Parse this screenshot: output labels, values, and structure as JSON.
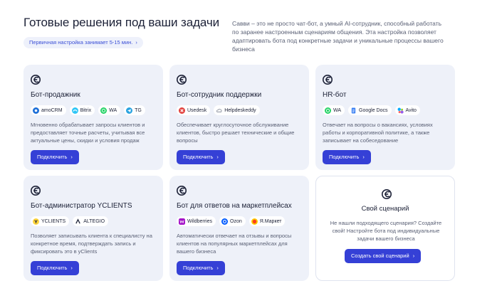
{
  "header": {
    "title": "Готовые решения под ваши задачи",
    "setup_chip": "Первичная настройка занимает 5-15 мин.",
    "intro": "Савви – это не просто чат-бот, а умный AI-сотрудник, способный работать по заранее настроенным сценариям общения. Эта настройка позволяет адаптировать бота под конкретные задачи и уникальные процессы вашего бизнеса"
  },
  "colors": {
    "accent": "#3540d6",
    "card_bg": "#eef1f9",
    "chip_bg": "#eef1fb"
  },
  "cards": [
    {
      "title": "Бот-продажник",
      "tags": [
        {
          "label": "amoCRM",
          "icon": "amocrm-icon"
        },
        {
          "label": "Bitrix",
          "icon": "bitrix-icon"
        },
        {
          "label": "WA",
          "icon": "whatsapp-icon"
        },
        {
          "label": "TG",
          "icon": "telegram-icon"
        }
      ],
      "desc": "Мгновенно обрабатывает запросы клиентов и предоставляет точные расчеты, учитывая все актуальные цены, скидки и условия продаж",
      "button": "Подключить"
    },
    {
      "title": "Бот-сотрудник поддержки",
      "tags": [
        {
          "label": "Usedesk",
          "icon": "usedesk-icon"
        },
        {
          "label": "Helpdeskeddy",
          "icon": "helpdeskeddy-icon"
        }
      ],
      "desc": "Обеспечивает круглосуточное обслуживание клиентов, быстро решает технические и общие вопросы",
      "button": "Подключить"
    },
    {
      "title": "HR-бот",
      "tags": [
        {
          "label": "WA",
          "icon": "whatsapp-icon"
        },
        {
          "label": "Google Docs",
          "icon": "google-docs-icon"
        },
        {
          "label": "Avito",
          "icon": "avito-icon"
        }
      ],
      "desc": "Отвечает на вопросы о вакансиях, условиях работы и корпоративной политике, а также записывает на собеседование",
      "button": "Подключить"
    },
    {
      "title": "Бот-администратор YCLIENTS",
      "tags": [
        {
          "label": "YCLIENTS",
          "icon": "yclients-icon"
        },
        {
          "label": "ALTEGIO",
          "icon": "altegio-icon"
        }
      ],
      "desc": "Позволяет записывать клиента к специалисту на конкретное время, подтверждать запись и фиксировать это в yClients",
      "button": "Подключить"
    },
    {
      "title": "Бот для ответов на маркетплейсах",
      "tags": [
        {
          "label": "Wildberries",
          "icon": "wildberries-icon"
        },
        {
          "label": "Ozon",
          "icon": "ozon-icon"
        },
        {
          "label": "Я.Маркет",
          "icon": "yandex-market-icon"
        }
      ],
      "desc": "Автоматически отвечает на отзывы и вопросы клиентов на популярных маркетплейсах для вашего бизнеса",
      "button": "Подключить"
    }
  ],
  "custom": {
    "title": "Свой сценарий",
    "desc": "Не нашли подходящего сценария? Создайте свой! Настройте бота под индивидуальные задачи вашего бизнеса",
    "button": "Создать свой сценарий"
  }
}
